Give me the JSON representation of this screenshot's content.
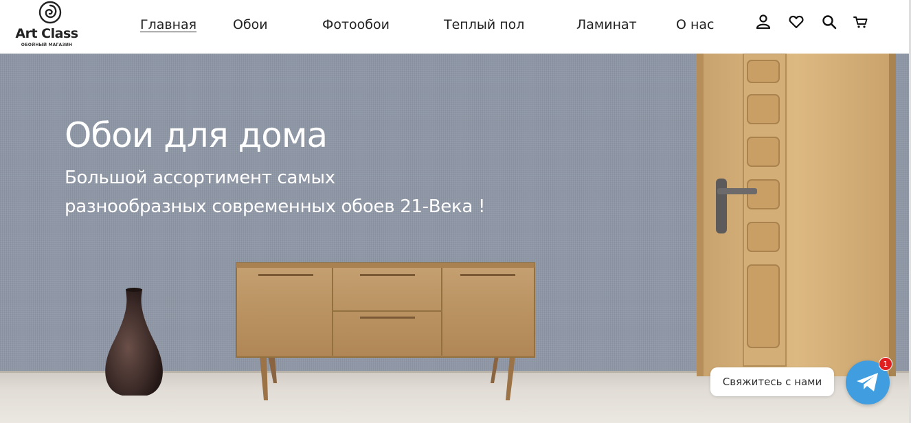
{
  "brand": {
    "name": "Art Class",
    "tagline": "ОБОЙНЫЙ МАГАЗИН"
  },
  "nav": {
    "items": [
      {
        "label": "Главная",
        "active": true
      },
      {
        "label": "Обои"
      },
      {
        "label": "Фотообои"
      },
      {
        "label": "Теплый пол"
      },
      {
        "label": "Ламинат"
      },
      {
        "label": "О нас"
      }
    ]
  },
  "header_icons": [
    "user-icon",
    "heart-icon",
    "search-icon",
    "cart-icon"
  ],
  "hero": {
    "title": "Обои для дома",
    "subtitle_line1": "Большой ассортимент самых",
    "subtitle_line2": "разнообразных современных обоев 21-Века !"
  },
  "chat": {
    "label": "Свяжитесь с нами",
    "badge": "1",
    "icon": "telegram-icon",
    "color": "#3f9de0",
    "badge_color": "#e02020"
  }
}
